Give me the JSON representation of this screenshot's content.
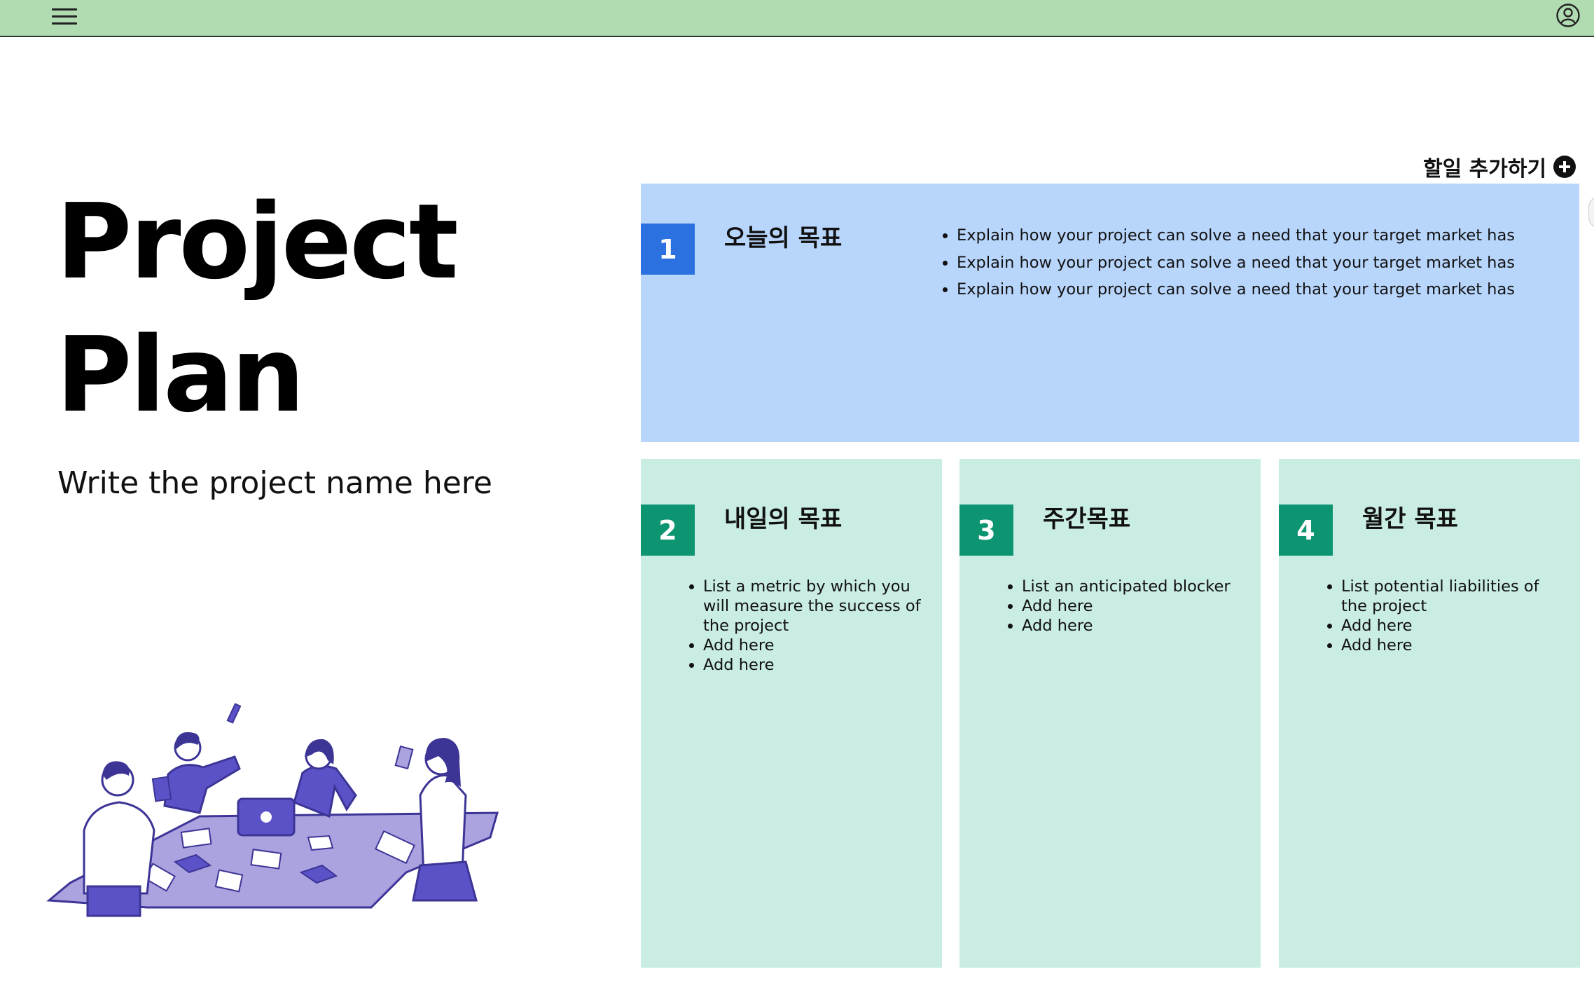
{
  "header": {
    "menu_icon": "hamburger-menu-icon",
    "user_icon": "user-account-icon",
    "background": "#b1dcb2"
  },
  "hero": {
    "title_line1": "Project",
    "title_line2": "Plan",
    "subtitle": "Write the project name here",
    "illustration": "team-collaboration-illustration"
  },
  "add_todo": {
    "label": "할일 추가하기",
    "icon": "plus-circle-icon"
  },
  "cards": [
    {
      "number": "1",
      "title": "오늘의 목표",
      "color": "#b8d5fb",
      "badge_color": "#2b72e0",
      "bullets": [
        "Explain how your project can solve a need that your target market has",
        "Explain how your project can solve a need that your target market has",
        "Explain how your project can solve a need that your target market has"
      ]
    },
    {
      "number": "2",
      "title": "내일의 목표",
      "color": "#c9ece3",
      "badge_color": "#0d9471",
      "bullets": [
        "List a metric by which you will measure the success of the project",
        "Add here",
        "Add here"
      ]
    },
    {
      "number": "3",
      "title": "주간목표",
      "color": "#c9ece3",
      "badge_color": "#0d9471",
      "bullets": [
        "List an anticipated blocker",
        "Add here",
        "Add here"
      ]
    },
    {
      "number": "4",
      "title": "월간 목표",
      "color": "#c9ece3",
      "badge_color": "#0d9471",
      "bullets": [
        "List potential liabilities of the project",
        "Add here",
        "Add here"
      ]
    }
  ]
}
